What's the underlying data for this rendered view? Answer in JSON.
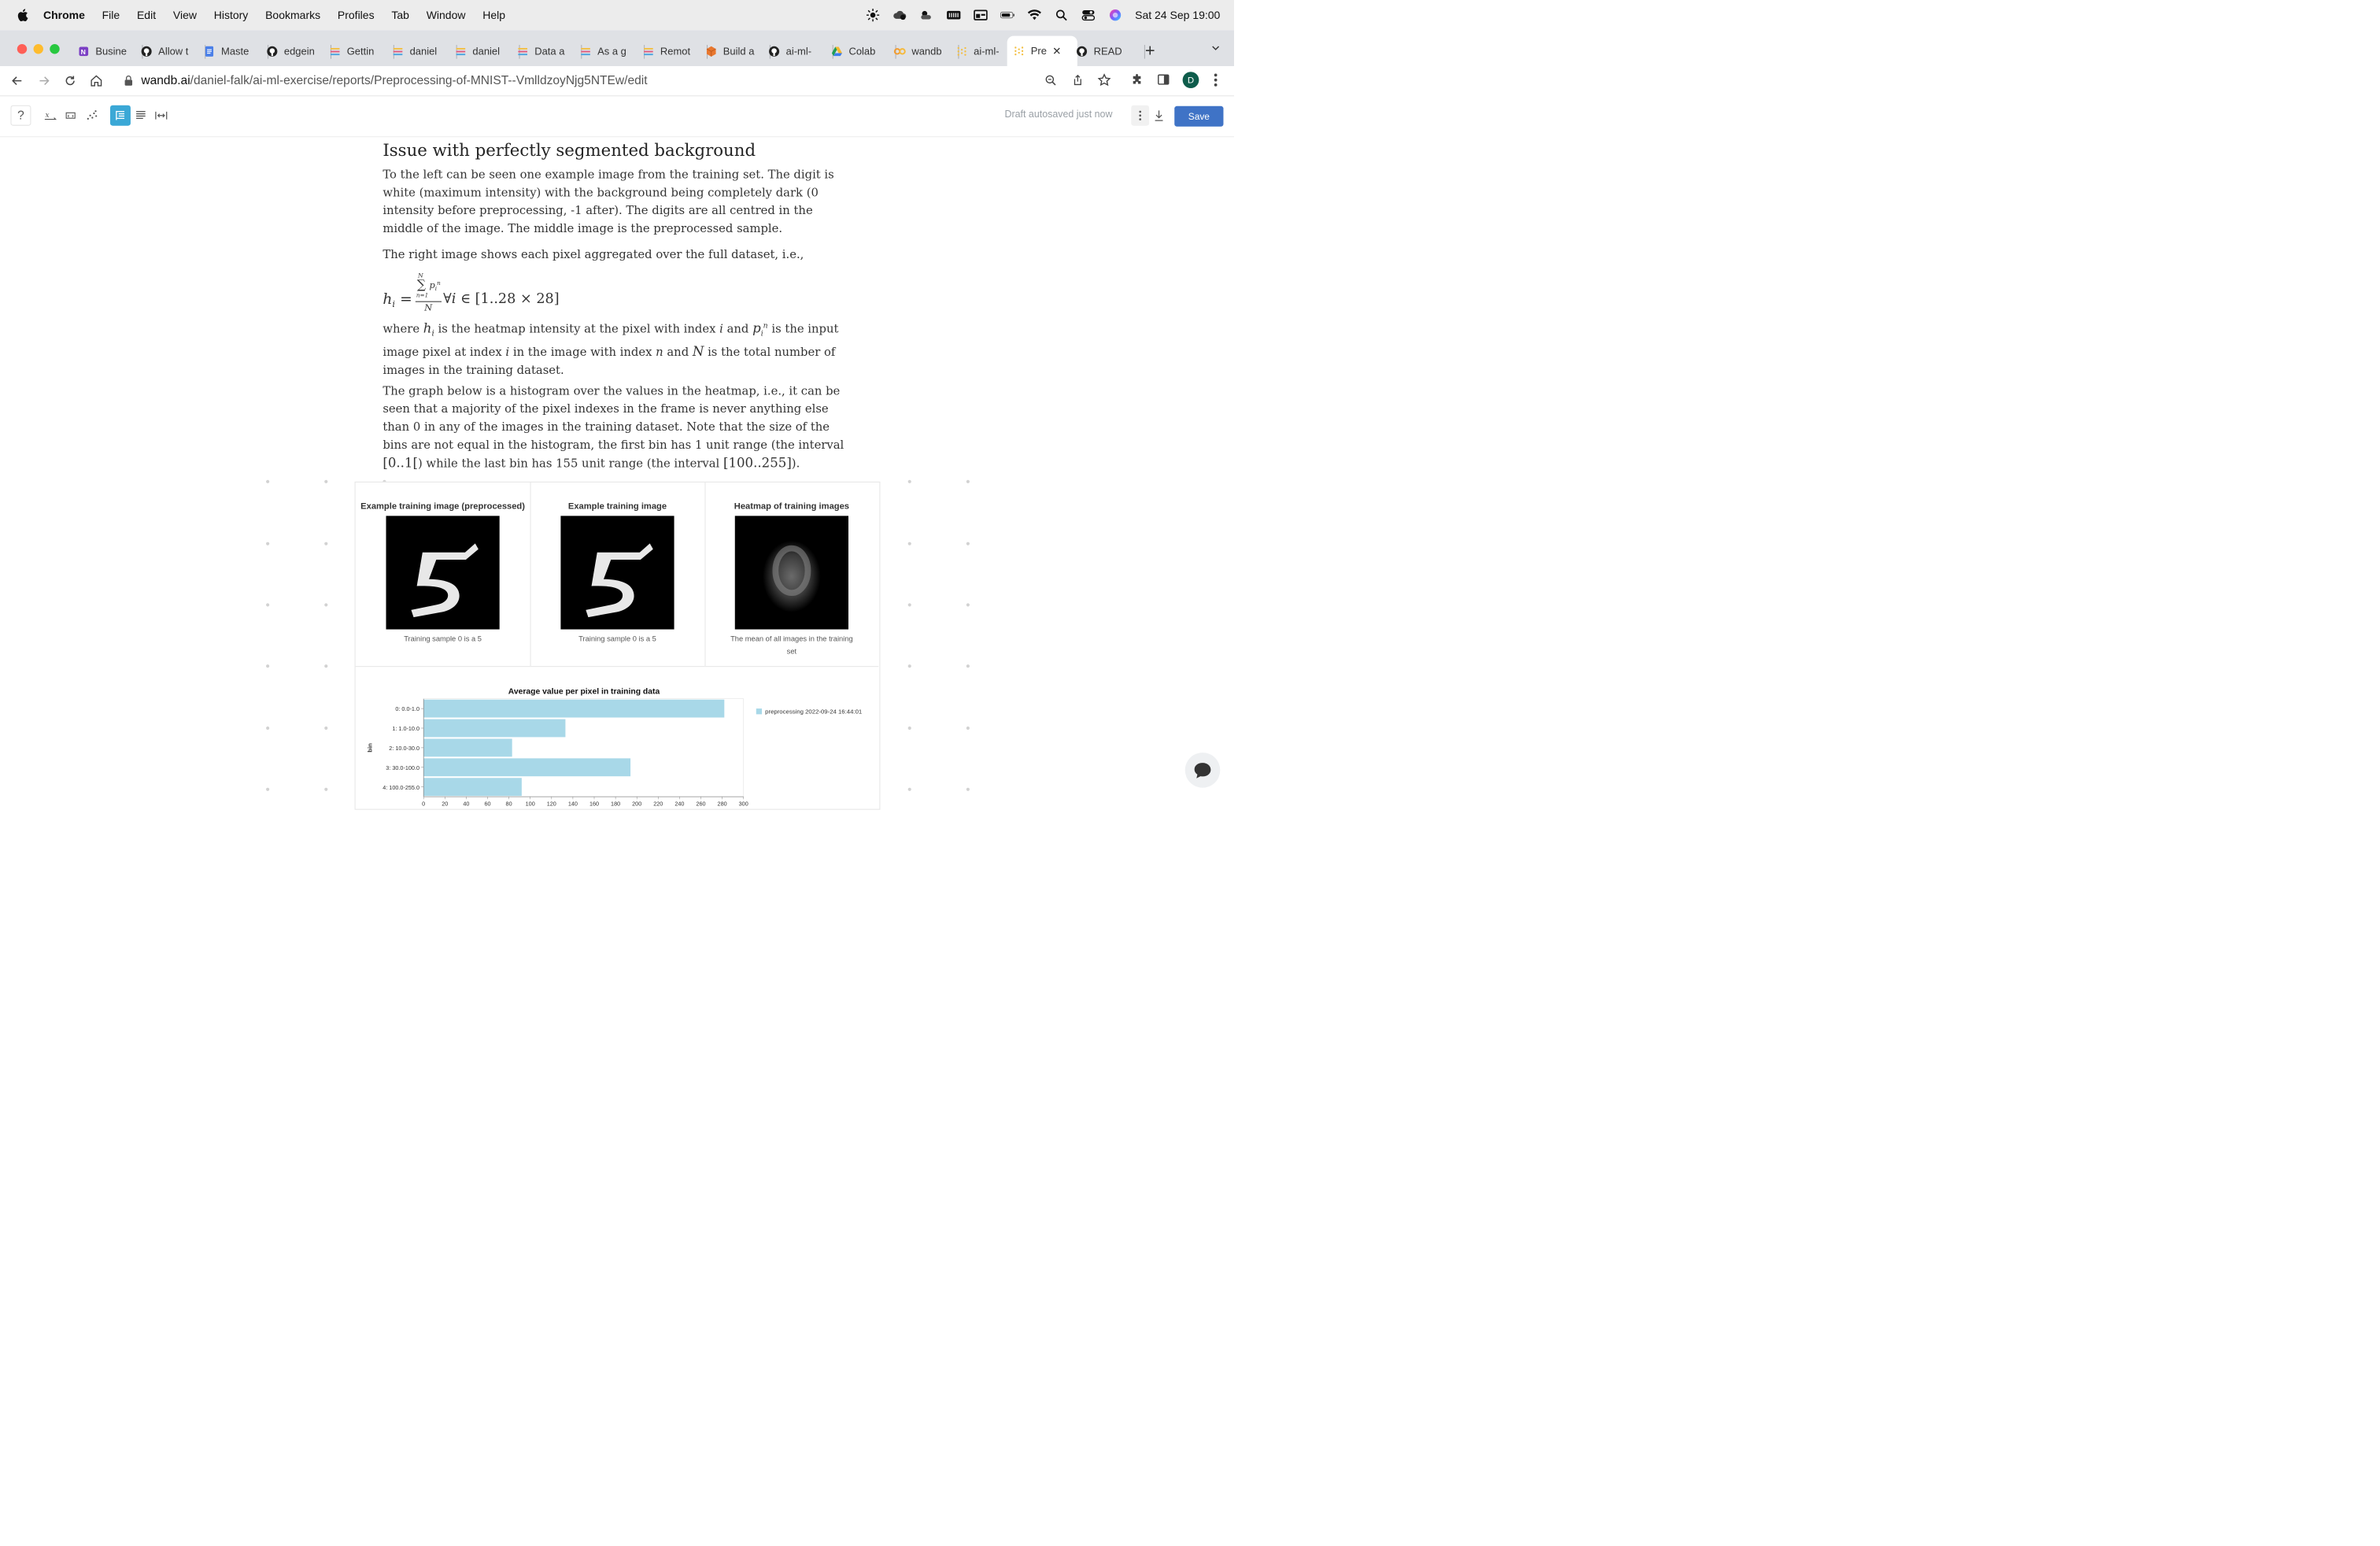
{
  "menubar": {
    "app": "Chrome",
    "items": [
      "File",
      "Edit",
      "View",
      "History",
      "Bookmarks",
      "Profiles",
      "Tab",
      "Window",
      "Help"
    ],
    "datetime": "Sat 24 Sep  19:00"
  },
  "tabs": [
    {
      "label": "Busine",
      "icon": "onenote-icon"
    },
    {
      "label": "Allow t",
      "icon": "github-icon"
    },
    {
      "label": "Maste",
      "icon": "docs-icon"
    },
    {
      "label": "edgein",
      "icon": "github-icon"
    },
    {
      "label": "Gettin",
      "icon": "wandb-icon"
    },
    {
      "label": "daniel",
      "icon": "wandb-icon"
    },
    {
      "label": "daniel",
      "icon": "wandb-icon"
    },
    {
      "label": "Data a",
      "icon": "wandb-icon"
    },
    {
      "label": "As a g",
      "icon": "wandb-icon"
    },
    {
      "label": "Remot",
      "icon": "wandb-icon"
    },
    {
      "label": "Build a",
      "icon": "box-icon"
    },
    {
      "label": "ai-ml-",
      "icon": "github-icon"
    },
    {
      "label": "Colab",
      "icon": "drive-icon"
    },
    {
      "label": "wandb",
      "icon": "colab-icon"
    },
    {
      "label": "ai-ml-",
      "icon": "wandb-dots-icon"
    },
    {
      "label": "Pre",
      "icon": "wandb-dots-icon",
      "active": true
    },
    {
      "label": "READ",
      "icon": "github-icon"
    }
  ],
  "address": {
    "host": "wandb.ai",
    "path": "/daniel-falk/ai-ml-exercise/reports/Preprocessing-of-MNIST--VmlldzoyNjg5NTEw/edit",
    "profile_initial": "D"
  },
  "toolbar": {
    "draft_status": "Draft autosaved just now",
    "save_label": "Save"
  },
  "report": {
    "heading": "Issue with perfectly segmented background",
    "p1": "To the left can be seen one example image from the training set. The digit is white (maximum intensity) with the background being completely dark (0 intensity before preprocessing, -1 after). The digits are all centred in the middle of the image. The middle image is the preprocessed sample.",
    "p2": "The right image shows each pixel aggregated over the full dataset, i.e.,",
    "p3_parts": [
      "where ",
      " is the heatmap intensity at the pixel with index ",
      " and ",
      " is the input image pixel at index ",
      " in the image with index ",
      " and ",
      " is the total number of images in the training dataset."
    ],
    "p4_parts": [
      "The graph below is a histogram over the values in the heatmap, i.e., it can be seen that a majority of the pixel indexes in the frame is never anything else than ",
      "0",
      " in any of the images in the training dataset. Note that the size of the bins are not equal in the histogram, the first bin has 1 unit range (the interval ",
      "[0..1[",
      ") while the last bin has 155 unit range (the interval ",
      "[100..255]",
      ")."
    ]
  },
  "panels": [
    {
      "title": "Example training image (preprocessed)",
      "caption": "Training sample 0 is a 5"
    },
    {
      "title": "Example training image",
      "caption": "Training sample 0 is a 5"
    },
    {
      "title": "Heatmap of training images",
      "caption": "The mean of all images in the training set"
    }
  ],
  "chart_data": {
    "type": "bar",
    "orientation": "horizontal",
    "title": "Average value per pixel in training data",
    "ylabel": "bin",
    "xlabel": "",
    "categories": [
      "0: 0.0-1.0",
      "1: 1.0-10.0",
      "2: 10.0-30.0",
      "3: 30.0-100.0",
      "4: 100.0-255.0"
    ],
    "series": [
      {
        "name": "preprocessing 2022-09-24 16:44:01",
        "values": [
          282,
          133,
          83,
          194,
          92
        ],
        "color": "#a8d8e8"
      }
    ],
    "xlim": [
      0,
      300
    ],
    "xticks": [
      0,
      20,
      40,
      60,
      80,
      100,
      120,
      140,
      160,
      180,
      200,
      220,
      240,
      260,
      280,
      300
    ],
    "legend_position": "right"
  },
  "colors": {
    "accent": "#3f73c6",
    "active_tool": "#3ba8d6"
  }
}
